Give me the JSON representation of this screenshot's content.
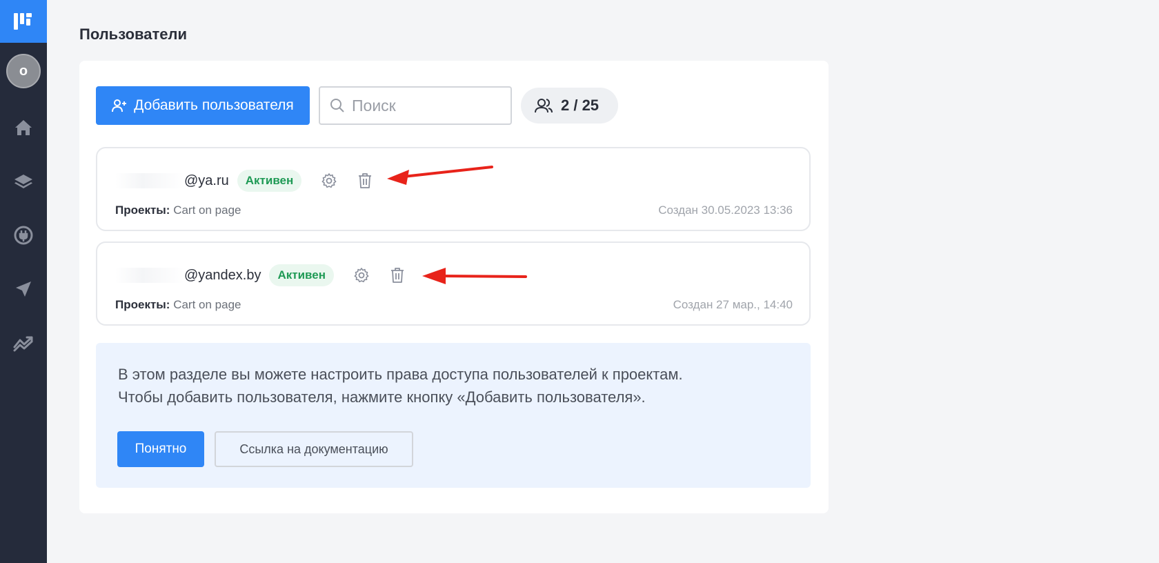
{
  "page": {
    "title": "Пользователи"
  },
  "sidebar": {
    "avatar_letter": "o",
    "items": [
      {
        "icon": "home-icon"
      },
      {
        "icon": "layers-icon"
      },
      {
        "icon": "plugin-icon"
      },
      {
        "icon": "send-icon"
      },
      {
        "icon": "analytics-icon"
      }
    ]
  },
  "toolbar": {
    "add_label": "Добавить пользователя",
    "search_placeholder": "Поиск",
    "counter": "2 / 25"
  },
  "users": [
    {
      "email": "@ya.ru",
      "status": "Активен",
      "projects_label": "Проекты:",
      "projects": "Cart on page",
      "created": "Создан 30.05.2023 13:36"
    },
    {
      "email": "@yandex.by",
      "status": "Активен",
      "projects_label": "Проекты:",
      "projects": "Cart on page",
      "created": "Создан 27 мар., 14:40"
    }
  ],
  "info": {
    "line1": "В этом разделе вы можете настроить права доступа пользователей к проектам.",
    "line2": "Чтобы добавить пользователя, нажмите кнопку «Добавить пользователя».",
    "ok_label": "Понятно",
    "docs_label": "Ссылка на документацию"
  },
  "colors": {
    "accent": "#2f86f6",
    "sidebar": "#252b3b",
    "active": "#1f9a55",
    "annotation_arrow": "#e8231a"
  }
}
